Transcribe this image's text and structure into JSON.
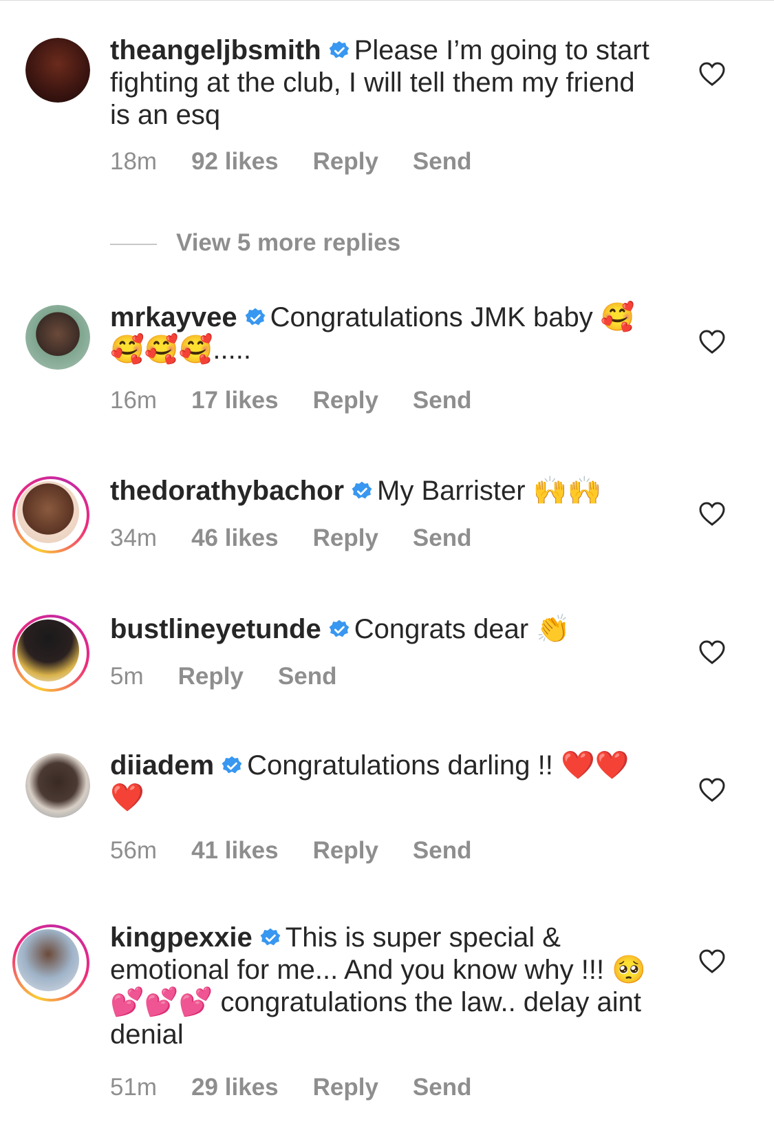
{
  "colors": {
    "text": "#262626",
    "meta": "#8e8e8e",
    "verified": "#3897f0",
    "heart": "#262626"
  },
  "view_more_replies": "View 5 more replies",
  "comments": [
    {
      "username": "theangeljbsmith",
      "text": "Please I’m going to start fighting at the club, I will tell them my friend is an esq",
      "time": "18m",
      "likes": "92 likes",
      "reply": "Reply",
      "send": "Send",
      "story_ring": false
    },
    {
      "username": "mrkayvee",
      "text": "Congratulations JMK baby 🥰🥰🥰🥰.....",
      "time": "16m",
      "likes": "17 likes",
      "reply": "Reply",
      "send": "Send",
      "story_ring": false
    },
    {
      "username": "thedorathybachor",
      "text": "My Barrister 🙌🙌",
      "time": "34m",
      "likes": "46 likes",
      "reply": "Reply",
      "send": "Send",
      "story_ring": true
    },
    {
      "username": "bustlineyetunde",
      "text": "Congrats dear 👏",
      "time": "5m",
      "likes": "",
      "reply": "Reply",
      "send": "Send",
      "story_ring": true
    },
    {
      "username": "diiadem",
      "text": "Congratulations darling !! ❤️❤️❤️",
      "time": "56m",
      "likes": "41 likes",
      "reply": "Reply",
      "send": "Send",
      "story_ring": false
    },
    {
      "username": "kingpexxie",
      "text": "This is super special & emotional for me... And you know why !!! 🥺💕💕💕 congratulations the law.. delay aint denial",
      "time": "51m",
      "likes": "29 likes",
      "reply": "Reply",
      "send": "Send",
      "story_ring": true
    }
  ]
}
